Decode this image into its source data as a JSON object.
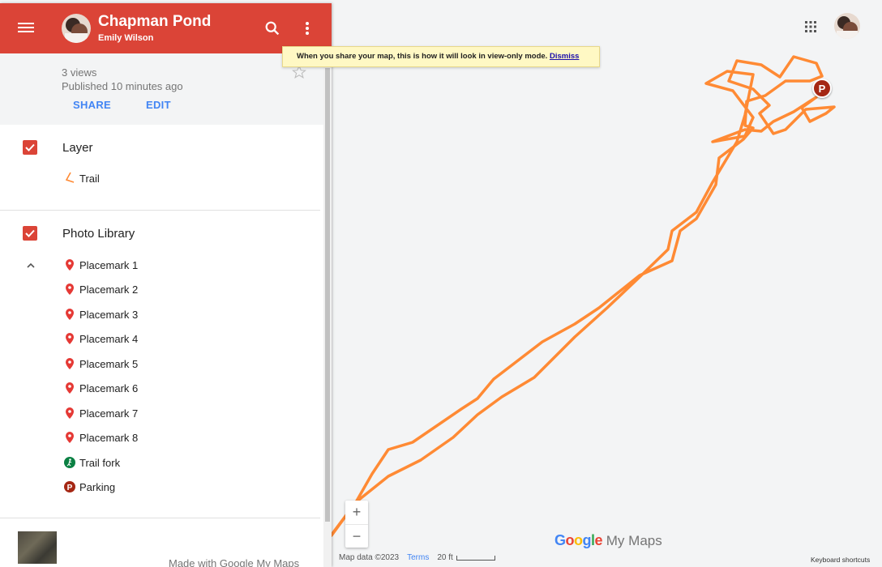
{
  "map": {
    "title": "Chapman Pond",
    "owner": "Emily Wilson",
    "views": "3 views",
    "published": "Published 10 minutes ago",
    "share_label": "SHARE",
    "edit_label": "EDIT",
    "route_color": "#ff8a34",
    "header_color": "#db4437"
  },
  "layers": [
    {
      "title": "Layer",
      "items": [
        {
          "label": "Trail",
          "icon": "trail-line-icon"
        }
      ]
    },
    {
      "title": "Photo Library",
      "items": [
        {
          "label": "Placemark 1",
          "icon": "red-pin-icon"
        },
        {
          "label": "Placemark 2",
          "icon": "red-pin-icon"
        },
        {
          "label": "Placemark 3",
          "icon": "red-pin-icon"
        },
        {
          "label": "Placemark 4",
          "icon": "red-pin-icon"
        },
        {
          "label": "Placemark 5",
          "icon": "red-pin-icon"
        },
        {
          "label": "Placemark 6",
          "icon": "red-pin-icon"
        },
        {
          "label": "Placemark 7",
          "icon": "red-pin-icon"
        },
        {
          "label": "Placemark 8",
          "icon": "red-pin-icon"
        },
        {
          "label": "Trail fork",
          "icon": "hiker-icon"
        },
        {
          "label": "Parking",
          "icon": "parking-icon"
        }
      ]
    }
  ],
  "made_with": "Made with Google My Maps",
  "banner": {
    "text": "When you share your map, this is how it will look in view-only mode.",
    "dismiss": "Dismiss"
  },
  "footer": {
    "map_data": "Map data ©2023",
    "terms": "Terms",
    "scale": "20 ft",
    "keyboard_shortcuts": "Keyboard shortcuts"
  },
  "logo": {
    "google": "Google",
    "product": " My Maps"
  },
  "parking_marker": "P",
  "zoom": {
    "in": "+",
    "out": "−"
  }
}
